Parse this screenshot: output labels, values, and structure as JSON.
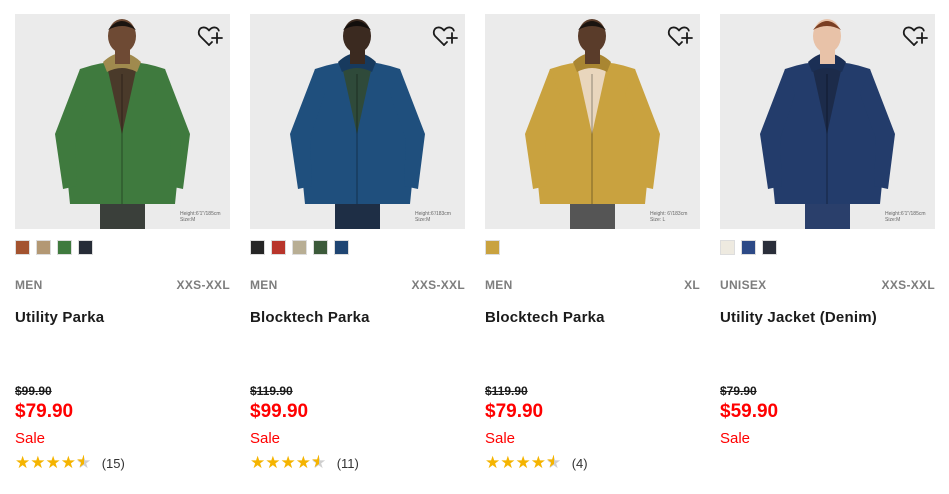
{
  "products": [
    {
      "gender": "MEN",
      "sizes": "XXS-XXL",
      "name": "Utility Parka",
      "original_price": "$99.90",
      "price": "$79.90",
      "sale_label": "Sale",
      "rating": 4.5,
      "review_count": "(15)",
      "model_caption": "Height:6'1\"/185cm Size:M",
      "jacket_color": "#3f7a3e",
      "lining_color": "#a08a4e",
      "colors": [
        "#a3532f",
        "#b39874",
        "#3f7a3e",
        "#262c37"
      ],
      "favorite_icon": "heart-plus-icon"
    },
    {
      "gender": "MEN",
      "sizes": "XXS-XXL",
      "name": "Blocktech Parka",
      "original_price": "$119.90",
      "price": "$99.90",
      "sale_label": "Sale",
      "rating": 4.5,
      "review_count": "(11)",
      "model_caption": "Height:6'/183cm Size:M",
      "jacket_color": "#1f4f7d",
      "lining_color": "#173a5e",
      "colors": [
        "#252525",
        "#b8352b",
        "#b8ae94",
        "#3c5a3a",
        "#1f4572"
      ],
      "favorite_icon": "heart-plus-icon"
    },
    {
      "gender": "MEN",
      "sizes": "XL",
      "name": "Blocktech Parka",
      "original_price": "$119.90",
      "price": "$79.90",
      "sale_label": "Sale",
      "rating": 4.5,
      "review_count": "(4)",
      "model_caption": "Height: 6'/183cm Size: L",
      "jacket_color": "#c9a23f",
      "lining_color": "#a98632",
      "colors": [
        "#c9a23f"
      ],
      "favorite_icon": "heart-plus-icon"
    },
    {
      "gender": "UNISEX",
      "sizes": "XXS-XXL",
      "name": "Utility Jacket (Denim)",
      "original_price": "$79.90",
      "price": "$59.90",
      "sale_label": "Sale",
      "rating": null,
      "review_count": null,
      "model_caption": "Height:6'1\"/185cm Size:M",
      "jacket_color": "#233c6b",
      "lining_color": "#1b2f55",
      "colors": [
        "#eeeae0",
        "#2d4a86",
        "#2a2e3a"
      ],
      "favorite_icon": "heart-plus-icon"
    }
  ]
}
